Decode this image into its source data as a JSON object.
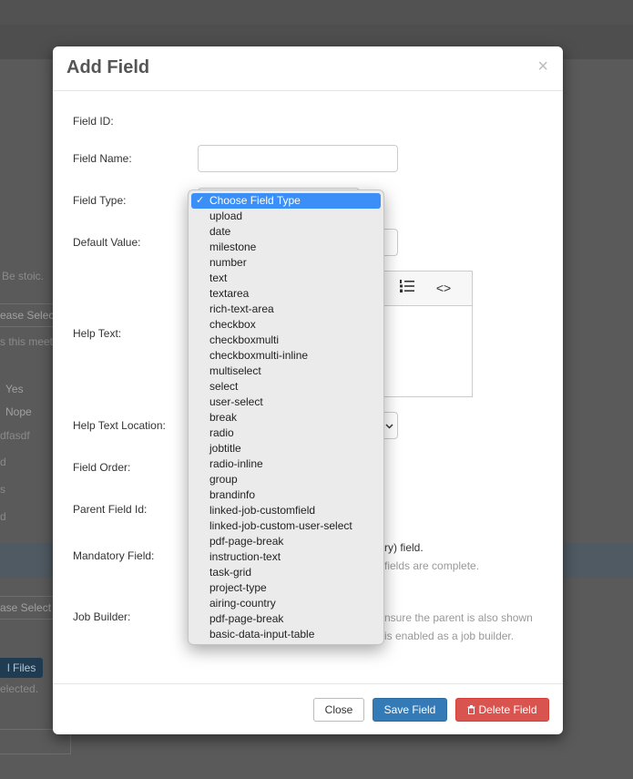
{
  "background": {
    "snippets": [
      "Be stoic.",
      "ease Select",
      "s this meet",
      "Yes",
      "Nope",
      "dfasdf",
      "d",
      "s",
      "d",
      "ase Select",
      "l Files",
      "elected."
    ]
  },
  "modal": {
    "title": "Add Field",
    "close_glyph": "×",
    "labels": {
      "field_id": "Field ID:",
      "field_name": "Field Name:",
      "field_type": "Field Type:",
      "default_value": "Default Value:",
      "help_text": "Help Text:",
      "help_text_location": "Help Text Location:",
      "field_order": "Field Order:",
      "parent_field_id": "Parent Field Id:",
      "mandatory_field": "Mandatory Field:",
      "job_builder": "Job Builder:"
    },
    "inputs": {
      "field_name_value": "",
      "default_value_value": ""
    },
    "editor_toolbar": {
      "ordered_list_icon": "ordered-list-icon",
      "code_glyph": "<>"
    },
    "partial_text": {
      "mandatory_line1": "ry) field.",
      "mandatory_line2": "fields are complete.",
      "job_builder_line1": "nsure the parent is also shown",
      "job_builder_line2": "is enabled as a job builder."
    },
    "footer": {
      "close_label": "Close",
      "save_label": "Save Field",
      "delete_label": "Delete Field"
    }
  },
  "field_type_dropdown": {
    "selected": "Choose Field Type",
    "options": [
      "Choose Field Type",
      "upload",
      "date",
      "milestone",
      "number",
      "text",
      "textarea",
      "rich-text-area",
      "checkbox",
      "checkboxmulti",
      "checkboxmulti-inline",
      "multiselect",
      "select",
      "user-select",
      "break",
      "radio",
      "jobtitle",
      "radio-inline",
      "group",
      "brandinfo",
      "linked-job-customfield",
      "linked-job-custom-user-select",
      "pdf-page-break",
      "instruction-text",
      "task-grid",
      "project-type",
      "airing-country",
      "pdf-page-break",
      "basic-data-input-table"
    ]
  },
  "colors": {
    "primary": "#337ab7",
    "danger": "#d9534f",
    "selected_option": "#3b8ff7"
  }
}
